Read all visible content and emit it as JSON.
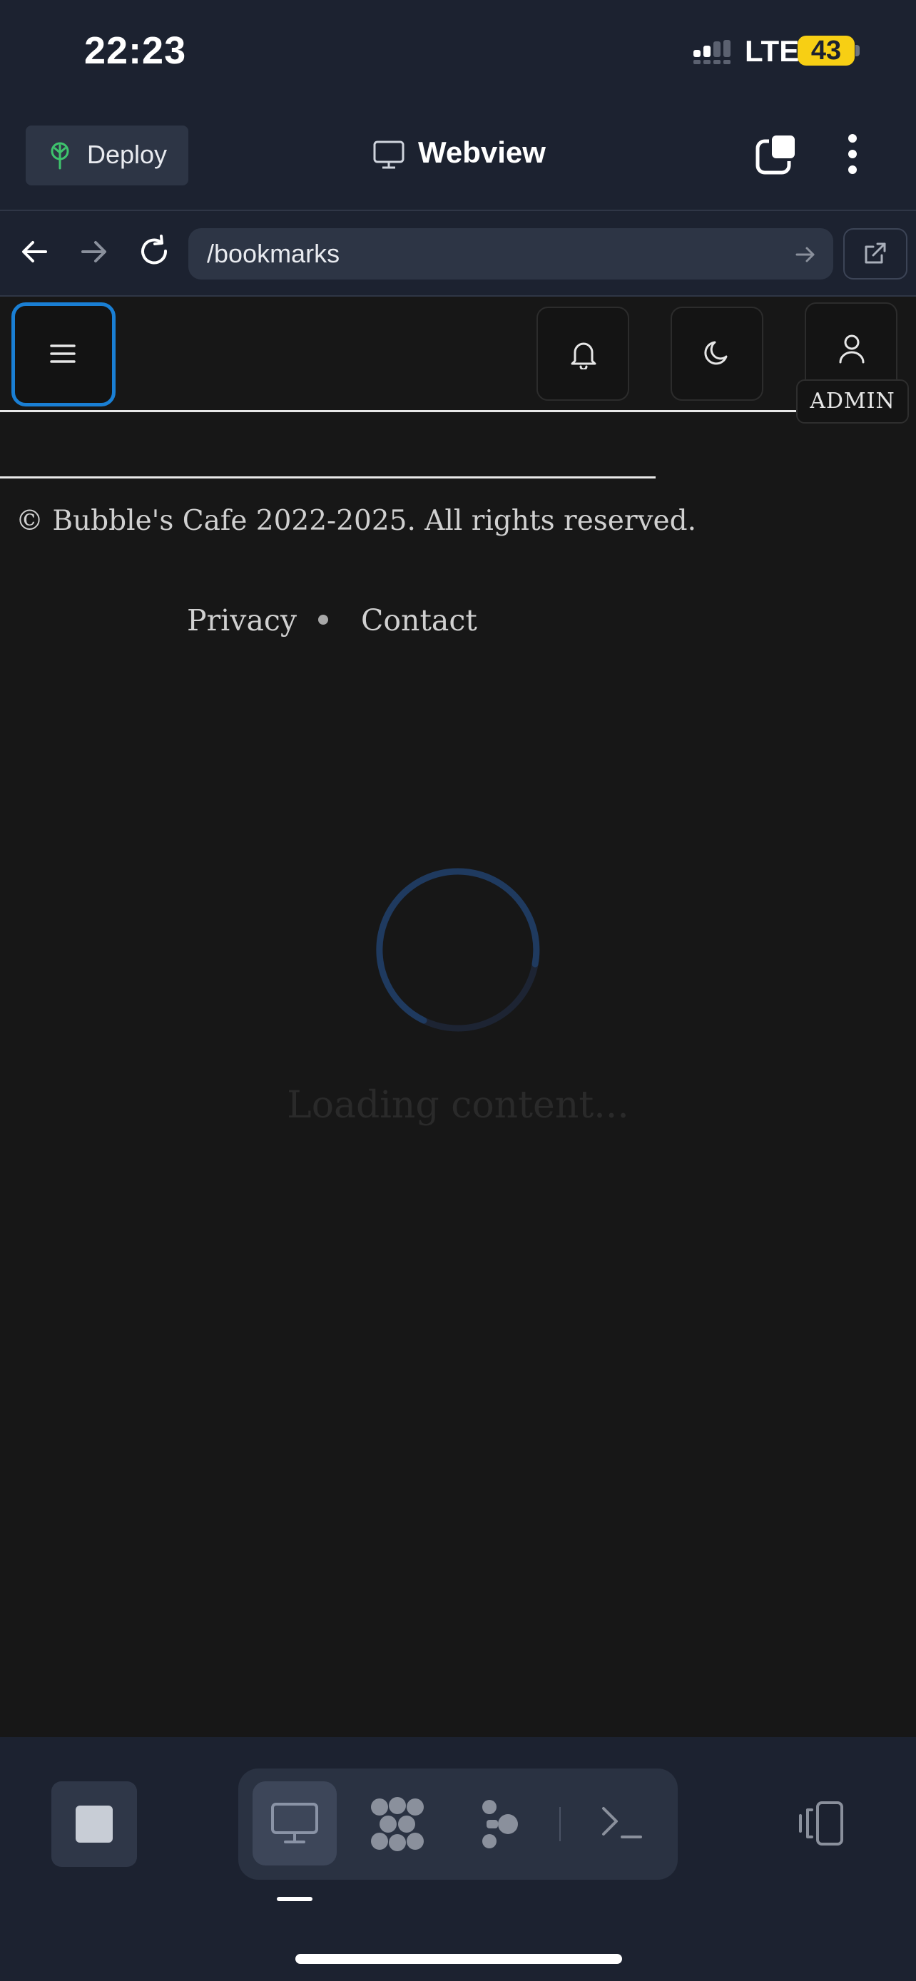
{
  "status_bar": {
    "time": "22:23",
    "network": "LTE",
    "battery": "43",
    "battery_color": "#f7cf14"
  },
  "app_header": {
    "deploy_label": "Deploy",
    "title": "Webview",
    "icons": [
      "deploy-icon",
      "monitor-icon",
      "tabs-icon",
      "kebab-menu-icon"
    ]
  },
  "nav_bar": {
    "url": "/bookmarks",
    "icons": [
      "back-arrow-icon",
      "forward-arrow-icon",
      "reload-icon",
      "go-arrow-icon",
      "external-link-icon"
    ]
  },
  "page": {
    "header_icons": [
      "hamburger-menu-icon",
      "bell-icon",
      "moon-icon",
      "user-icon"
    ],
    "user_badge": "ADMIN",
    "footer": {
      "copyright": "© Bubble's Cafe 2022-2025. All rights reserved.",
      "links": [
        "Privacy",
        "Contact"
      ]
    },
    "loading_text": "Loading content...",
    "accent_color": "#1a7fd4"
  },
  "bottom_toolbar": {
    "icons": [
      "stop-icon",
      "desktop-icon",
      "cluster-icon",
      "share-nodes-icon",
      "terminal-icon",
      "devices-icon"
    ],
    "active_mode": "desktop"
  }
}
